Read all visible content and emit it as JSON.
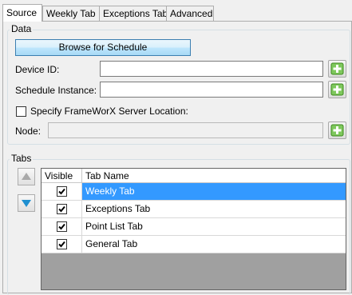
{
  "tabs": [
    {
      "label": "Source",
      "active": true
    },
    {
      "label": "Weekly Tab",
      "active": false
    },
    {
      "label": "Exceptions Tab",
      "active": false
    },
    {
      "label": "Advanced",
      "active": false
    }
  ],
  "data_group": {
    "title": "Data",
    "browse_label": "Browse for Schedule",
    "device_id_label": "Device ID:",
    "device_id_value": "",
    "schedule_instance_label": "Schedule Instance:",
    "schedule_instance_value": "",
    "specify_server_label": "Specify FrameWorX Server Location:",
    "specify_server_checked": false,
    "node_label": "Node:",
    "node_value": ""
  },
  "tabs_group": {
    "title": "Tabs",
    "columns": [
      "Visible",
      "Tab Name"
    ],
    "rows": [
      {
        "visible": true,
        "name": "Weekly Tab",
        "selected": true
      },
      {
        "visible": true,
        "name": "Exceptions Tab",
        "selected": false
      },
      {
        "visible": true,
        "name": "Point List Tab",
        "selected": false
      },
      {
        "visible": true,
        "name": "General Tab",
        "selected": false
      }
    ]
  },
  "icons": {
    "plus_button": "green-plus-icon",
    "up_button": "arrow-up-icon",
    "down_button": "arrow-down-icon"
  },
  "colors": {
    "selection": "#3399ff",
    "grid_background": "#a0a0a0",
    "plus_green": "#4aa82a"
  }
}
